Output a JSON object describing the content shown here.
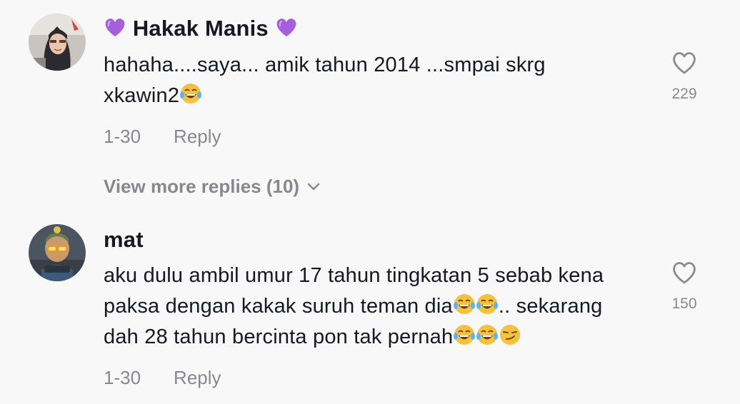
{
  "comments": [
    {
      "username": "💜Hakak Manis💜",
      "text_lines": [
        "hahaha....saya... amik tahun 2014 ...smpai skrg",
        "xkawin2😂"
      ],
      "date": "1-30",
      "reply_label": "Reply",
      "likes": "229",
      "avatar_icon": "avatar-hijab-woman"
    },
    {
      "username": "mat",
      "text_lines": [
        "aku dulu ambil umur 17 tahun tingkatan 5 sebab kena",
        "paksa dengan kakak suruh teman dia😂😂.. sekarang",
        "dah 28 tahun bercinta pon tak pernah😂😂😏"
      ],
      "date": "1-30",
      "reply_label": "Reply",
      "likes": "150",
      "avatar_icon": "avatar-game-character"
    }
  ],
  "view_more_replies": "View more replies (10)",
  "icons": {
    "like": "heart-outline-icon",
    "expand": "chevron-down-icon"
  },
  "colors": {
    "background": "#f8f8f8",
    "text_primary": "#161823",
    "text_secondary": "rgba(22,24,35,0.5)",
    "purple_heart": "#9b59d6",
    "laugh_emoji": "#f7c23a"
  }
}
